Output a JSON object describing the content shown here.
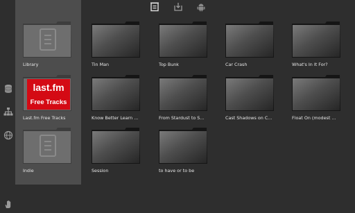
{
  "colors": {
    "background": "#2e2e2e",
    "panel": "#4d4d4d",
    "accent_lastfm": "#d40a14",
    "text": "#e8e8e8"
  },
  "topbar": {
    "icons": [
      "playlist-icon",
      "download-icon",
      "android-icon"
    ]
  },
  "leftrail": {
    "icons": [
      "database-icon",
      "network-tree-icon",
      "globe-icon",
      "hand-icon"
    ]
  },
  "sidebar": {
    "items": [
      {
        "label": "Library"
      },
      {
        "label": "Last.fm Free Tracks",
        "badge_line1": "last.fm",
        "badge_line2": "Free Tracks"
      },
      {
        "label": "Indie"
      }
    ]
  },
  "grid": {
    "items": [
      {
        "label": "Tin Man"
      },
      {
        "label": "Top Bunk"
      },
      {
        "label": "Car Crash"
      },
      {
        "label": "What's In It For?"
      },
      {
        "label": "Know Better Learn ..."
      },
      {
        "label": "From Stardust to S..."
      },
      {
        "label": "Cast Shadows on C..."
      },
      {
        "label": "Float On (modest ..."
      },
      {
        "label": "Session"
      },
      {
        "label": "to have or to be"
      }
    ]
  }
}
